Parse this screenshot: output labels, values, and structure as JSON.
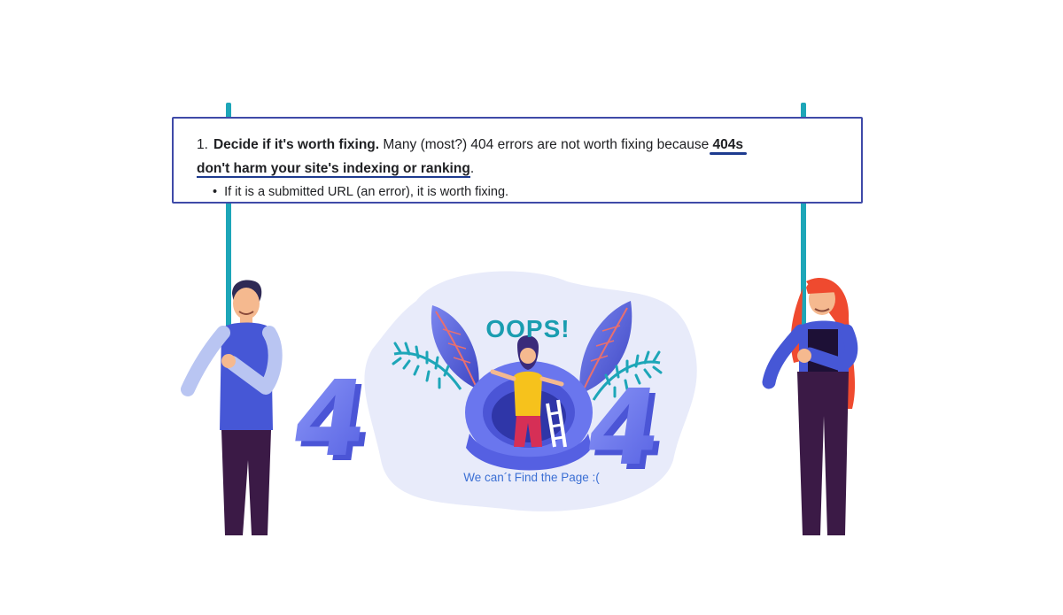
{
  "banner": {
    "number": "1.",
    "lead": "Decide if it's worth fixing.",
    "middle": " Many (most?) 404 errors are not worth fixing because ",
    "emph_start": "404s",
    "emph_rest": "don't harm your site's indexing or ranking",
    "end": ".",
    "sub_bullet": "•",
    "sub_text": "If it is a submitted URL (an error), it is worth fixing."
  },
  "illustration": {
    "oops": "OOPS!",
    "digit_left": "4",
    "digit_right": "4",
    "caption": "We can´t Find the Page :("
  },
  "colors": {
    "pole": "#1da6b8",
    "banner_border": "#3f4aa8",
    "underline": "#1d3b8f",
    "digits": "#6f7cf0",
    "oops": "#1a9db0"
  }
}
